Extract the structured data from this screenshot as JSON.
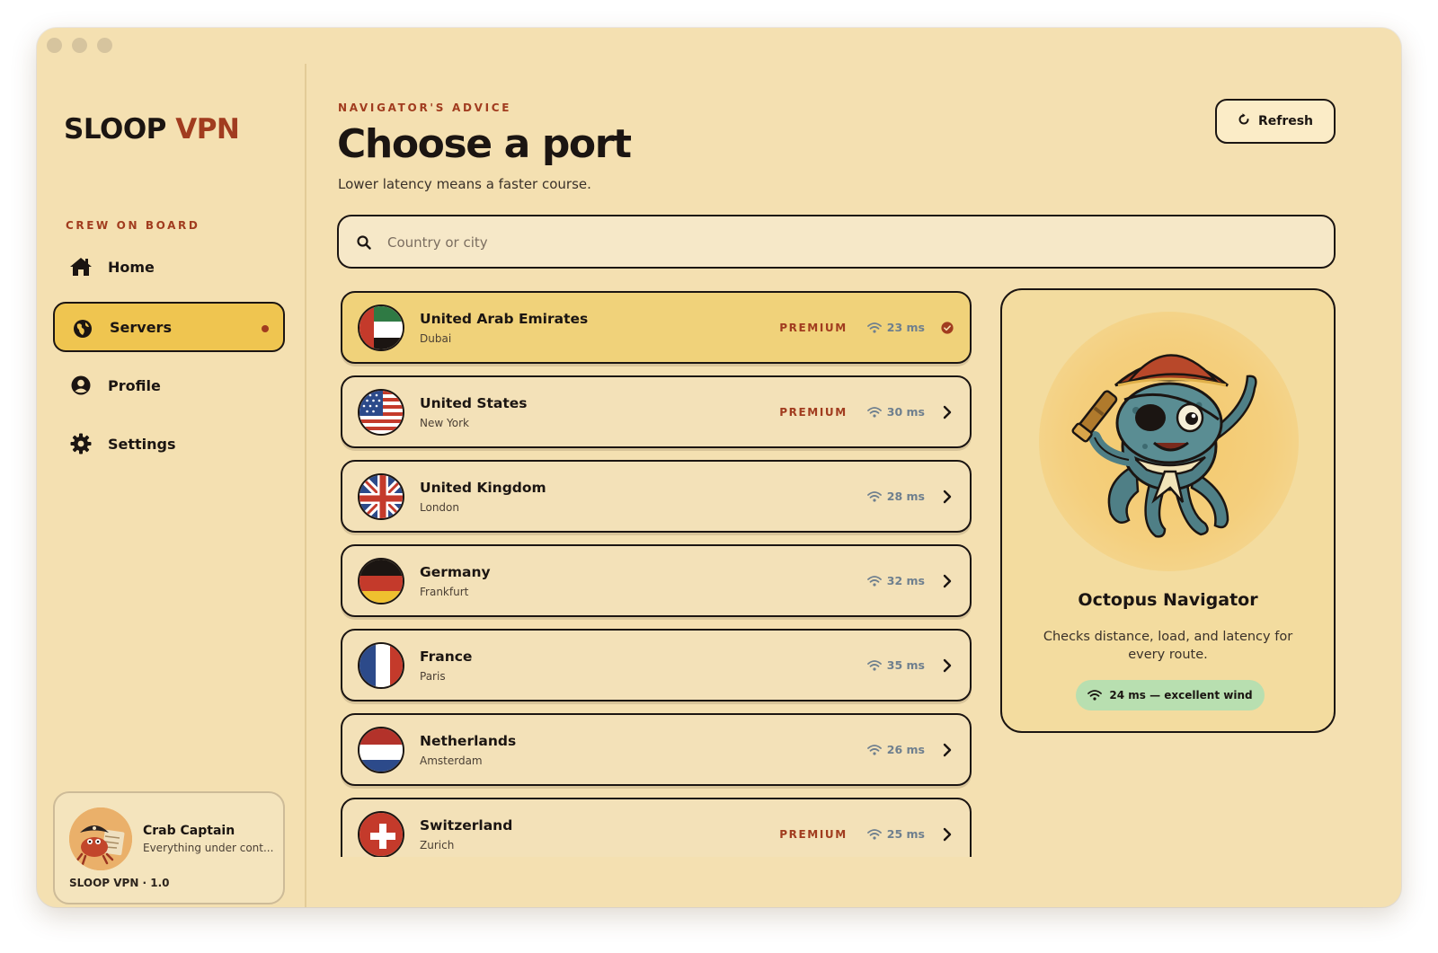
{
  "app": {
    "brand_primary": "SLOOP",
    "brand_accent": "VPN",
    "accent_color": "#a13c1f",
    "highlight_color": "#efc550"
  },
  "sidebar": {
    "section_label": "CREW ON BOARD",
    "items": [
      {
        "label": "Home",
        "icon": "home-icon",
        "active": false
      },
      {
        "label": "Servers",
        "icon": "globe-icon",
        "active": true
      },
      {
        "label": "Profile",
        "icon": "user-icon",
        "active": false
      },
      {
        "label": "Settings",
        "icon": "gear-icon",
        "active": false
      }
    ],
    "profile": {
      "name": "Crab Captain",
      "status": "Everything under cont...",
      "version": "SLOOP VPN · 1.0"
    }
  },
  "main": {
    "eyebrow": "NAVIGATOR'S ADVICE",
    "title": "Choose a port",
    "subtitle": "Lower latency means a faster course.",
    "refresh_label": "Refresh",
    "search": {
      "placeholder": "Country or city",
      "value": ""
    }
  },
  "servers": [
    {
      "country": "United Arab Emirates",
      "city": "Dubai",
      "premium": "PREMIUM",
      "latency": "23 ms",
      "selected": true,
      "flag": "uae"
    },
    {
      "country": "United States",
      "city": "New York",
      "premium": "PREMIUM",
      "latency": "30 ms",
      "selected": false,
      "flag": "us"
    },
    {
      "country": "United Kingdom",
      "city": "London",
      "premium": "",
      "latency": "28 ms",
      "selected": false,
      "flag": "uk"
    },
    {
      "country": "Germany",
      "city": "Frankfurt",
      "premium": "",
      "latency": "32 ms",
      "selected": false,
      "flag": "de"
    },
    {
      "country": "France",
      "city": "Paris",
      "premium": "",
      "latency": "35 ms",
      "selected": false,
      "flag": "fr"
    },
    {
      "country": "Netherlands",
      "city": "Amsterdam",
      "premium": "",
      "latency": "26 ms",
      "selected": false,
      "flag": "nl"
    },
    {
      "country": "Switzerland",
      "city": "Zurich",
      "premium": "PREMIUM",
      "latency": "25 ms",
      "selected": false,
      "flag": "ch"
    }
  ],
  "advisor": {
    "name": "Octopus Navigator",
    "description": "Checks distance, load, and latency for every route.",
    "status": "24 ms — excellent wind"
  }
}
